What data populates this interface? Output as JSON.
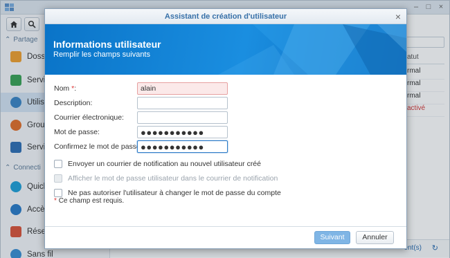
{
  "background_app": {
    "sidebar": {
      "sections": [
        {
          "label": "Partage"
        },
        {
          "label": "Connecti"
        }
      ],
      "items": [
        {
          "label": "Dossie",
          "icon": "folder-share-icon",
          "color": "#f0a030"
        },
        {
          "label": "Service",
          "icon": "file-services-icon",
          "color": "#3aa356"
        },
        {
          "label": "Utilisat",
          "icon": "user-icon",
          "color": "#3b86c6"
        },
        {
          "label": "Groupe",
          "icon": "group-icon",
          "color": "#e26f2a"
        },
        {
          "label": "Service",
          "icon": "domain-icon",
          "color": "#2f6fb5"
        },
        {
          "label": "QuickC",
          "icon": "quickconnect-icon",
          "color": "#1fa0d8"
        },
        {
          "label": "Accès e",
          "icon": "external-access-icon",
          "color": "#2a7cc9"
        },
        {
          "label": "Réseau",
          "icon": "network-icon",
          "color": "#d9543a"
        },
        {
          "label": "Sans fil",
          "icon": "wifi-icon",
          "color": "#3b8fd4"
        }
      ]
    },
    "table": {
      "status_header": "atut",
      "status_rows": [
        {
          "text": "rmal",
          "color": "#333333"
        },
        {
          "text": "rmal",
          "color": "#333333"
        },
        {
          "text": "rmal",
          "color": "#333333"
        },
        {
          "text": "activé",
          "color": "#d33a3a"
        }
      ]
    },
    "footer_text": "ent(s)"
  },
  "dialog": {
    "title": "Assistant de création d'utilisateur",
    "banner_title": "Informations utilisateur",
    "banner_subtitle": "Remplir les champs suivants",
    "fields": {
      "name": {
        "label": "Nom",
        "required_mark": "*",
        "colon": ":",
        "value": "alain"
      },
      "description": {
        "label": "Description:",
        "value": ""
      },
      "email": {
        "label": "Courrier électronique:",
        "value": ""
      },
      "password": {
        "label": "Mot de passe:",
        "value": "●●●●●●●●●●●"
      },
      "confirm_password": {
        "label": "Confirmez le mot de passe:",
        "value": "●●●●●●●●●●●"
      }
    },
    "options": [
      {
        "label": "Envoyer un courrier de notification au nouvel utilisateur créé",
        "checked": false,
        "disabled": false
      },
      {
        "label": "Afficher le mot de passe utilisateur dans le courrier de notification",
        "checked": false,
        "disabled": true
      },
      {
        "label": "Ne pas autoriser l'utilisateur à changer le mot de passe du compte",
        "checked": false,
        "disabled": false
      }
    ],
    "required_note": {
      "mark": "*",
      "text": "Ce champ est requis."
    },
    "buttons": {
      "next": "Suivant",
      "cancel": "Annuler"
    },
    "accent_color": "#1a8ee0"
  }
}
